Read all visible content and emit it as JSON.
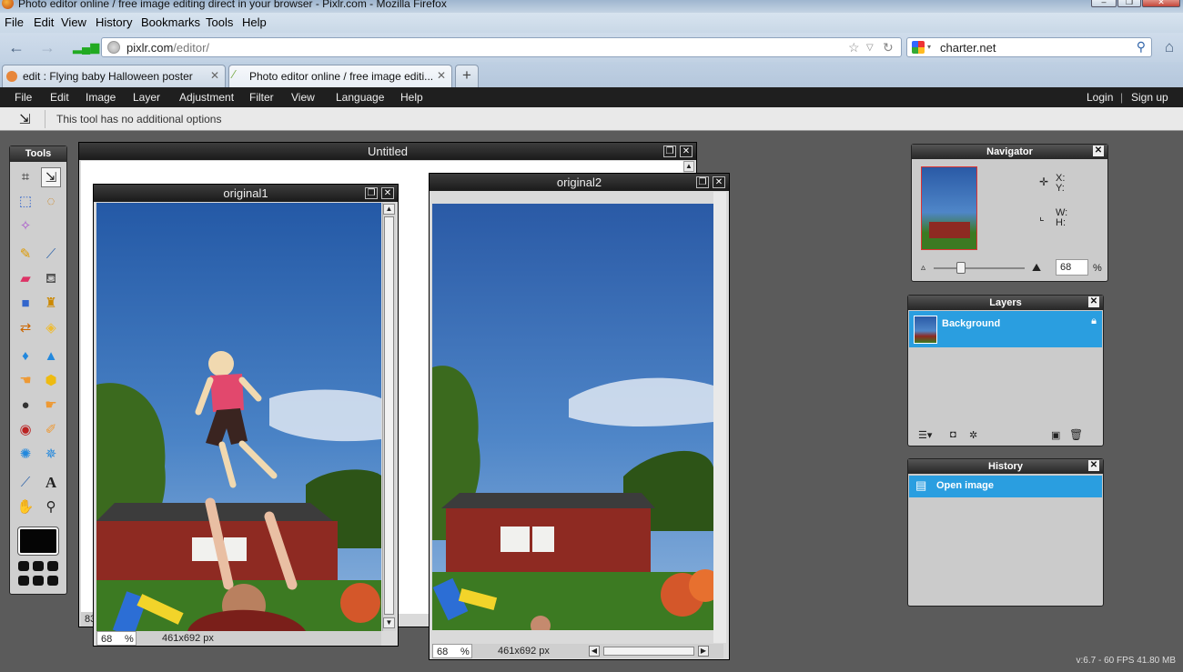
{
  "browser": {
    "window_title": "Photo editor online / free image editing direct in your browser - Pixlr.com - Mozilla Firefox",
    "menu": [
      "File",
      "Edit",
      "View",
      "History",
      "Bookmarks",
      "Tools",
      "Help"
    ],
    "url": "pixlr.com",
    "url_path": "/editor/",
    "search_text": "charter.net",
    "tabs": [
      {
        "label": "edit : Flying baby Halloween poster",
        "active": false
      },
      {
        "label": "Photo editor online / free image editi...",
        "active": true
      }
    ],
    "new_tab_label": "+"
  },
  "pixlr": {
    "menu": [
      "File",
      "Edit",
      "Image",
      "Layer",
      "Adjustment",
      "Filter",
      "View",
      "Language",
      "Help"
    ],
    "login": "Login",
    "separator": "|",
    "signup": "Sign up",
    "options_text": "This tool has no additional options",
    "tools_title": "Tools",
    "foreground_color": "#050505"
  },
  "documents": {
    "untitled": {
      "title": "Untitled",
      "zoom_partial": "83"
    },
    "original1": {
      "title": "original1",
      "zoom": "68",
      "zoom_unit": "%",
      "size": "461x692 px"
    },
    "original2": {
      "title": "original2",
      "zoom": "68",
      "zoom_unit": "%",
      "size": "461x692 px"
    }
  },
  "navigator": {
    "title": "Navigator",
    "x_label": "X:",
    "y_label": "Y:",
    "w_label": "W:",
    "h_label": "H:",
    "zoom": "68",
    "zoom_unit": "%",
    "zoom_level": 0.28
  },
  "layers": {
    "title": "Layers",
    "items": [
      {
        "name": "Background",
        "locked": true,
        "selected": true
      }
    ]
  },
  "history": {
    "title": "History",
    "items": [
      {
        "name": "Open image",
        "selected": true
      }
    ]
  },
  "version": "v:6.7 - 60 FPS 41.80 MB",
  "colors": {
    "accent": "#2a9ee0",
    "pixlr_menu_bg": "#1f1f1f",
    "workspace_bg": "#5b5b5b"
  }
}
